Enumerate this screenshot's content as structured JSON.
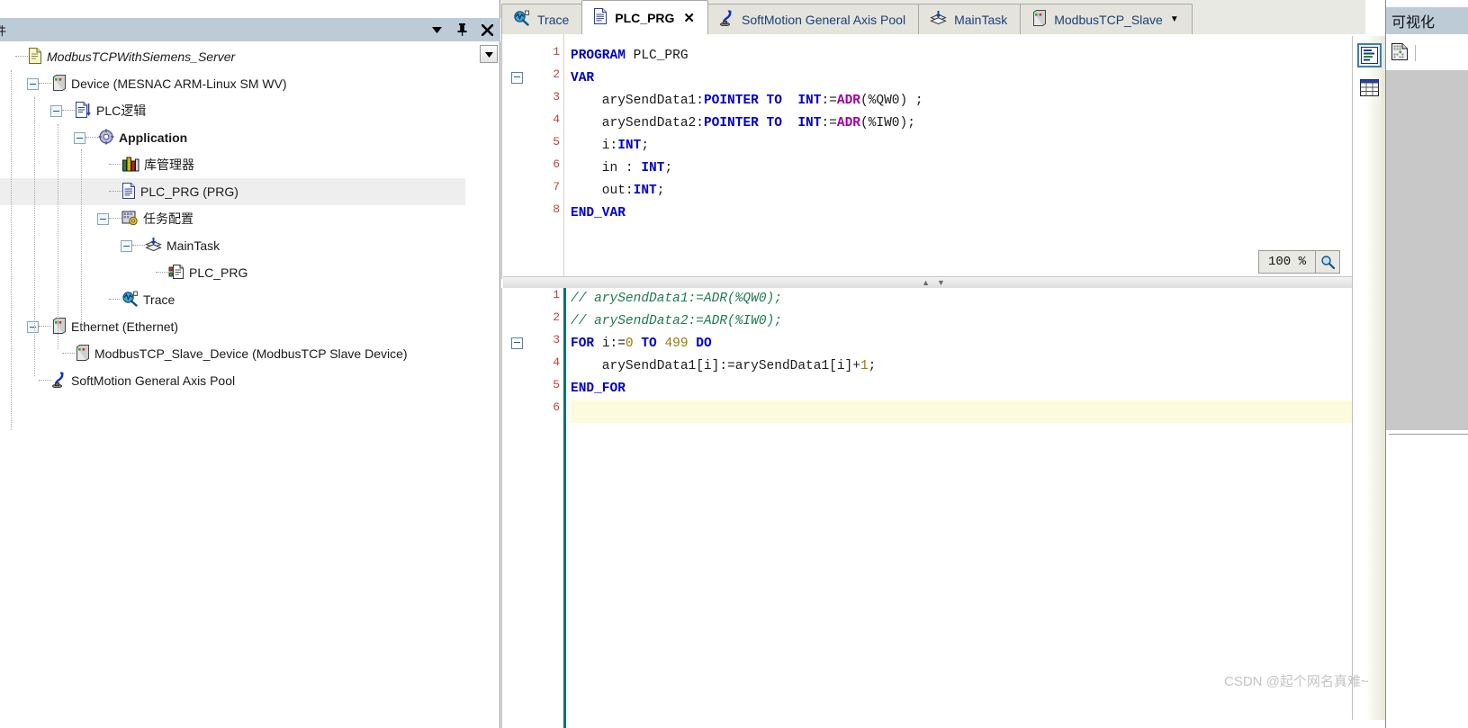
{
  "devices_panel": {
    "title": "件",
    "header_buttons": [
      {
        "name": "dropdown",
        "glyph": "▼"
      },
      {
        "name": "pin",
        "glyph": "⚐"
      },
      {
        "name": "close",
        "glyph": "✕"
      }
    ],
    "tree": [
      {
        "label": "ModbusTCPWithSiemens_Server",
        "icon": "project-icon",
        "indent": 0,
        "expander": "none",
        "style": "italic",
        "selected": false
      },
      {
        "label": "Device (MESNAC ARM-Linux SM WV)",
        "icon": "device-icon",
        "indent": 1,
        "expander": "minus",
        "style": "normal",
        "selected": false
      },
      {
        "label": "PLC逻辑",
        "icon": "plc-logic-icon",
        "indent": 2,
        "expander": "minus",
        "style": "normal",
        "selected": false
      },
      {
        "label": "Application",
        "icon": "application-icon",
        "indent": 3,
        "expander": "minus",
        "style": "bold",
        "selected": false
      },
      {
        "label": "库管理器",
        "icon": "library-manager-icon",
        "indent": 4,
        "expander": "none",
        "style": "normal",
        "selected": false
      },
      {
        "label": "PLC_PRG (PRG)",
        "icon": "pou-icon",
        "indent": 4,
        "expander": "none",
        "style": "normal",
        "selected": true
      },
      {
        "label": "任务配置",
        "icon": "task-config-icon",
        "indent": 4,
        "expander": "minus",
        "style": "normal",
        "selected": false
      },
      {
        "label": "MainTask",
        "icon": "task-icon",
        "indent": 5,
        "expander": "minus",
        "style": "normal",
        "selected": false
      },
      {
        "label": "PLC_PRG",
        "icon": "task-pou-icon",
        "indent": 6,
        "expander": "none",
        "style": "normal",
        "selected": false
      },
      {
        "label": "Trace",
        "icon": "trace-icon",
        "indent": 4,
        "expander": "none",
        "style": "normal",
        "selected": false
      },
      {
        "label": "Ethernet (Ethernet)",
        "icon": "device-icon",
        "indent": 1,
        "expander": "minus",
        "style": "normal",
        "selected": false
      },
      {
        "label": "ModbusTCP_Slave_Device (ModbusTCP Slave Device)",
        "icon": "device-icon",
        "indent": 2,
        "expander": "none",
        "style": "normal",
        "selected": false
      },
      {
        "label": "SoftMotion General Axis Pool",
        "icon": "softmotion-icon",
        "indent": 1,
        "expander": "none",
        "style": "normal",
        "selected": false
      }
    ]
  },
  "editor": {
    "tabs": [
      {
        "label": "Trace",
        "icon": "trace-icon",
        "active": false,
        "closable": false,
        "caret": false
      },
      {
        "label": "PLC_PRG",
        "icon": "pou-icon",
        "active": true,
        "closable": true,
        "caret": false
      },
      {
        "label": "SoftMotion General Axis Pool",
        "icon": "softmotion-icon",
        "active": false,
        "closable": false,
        "caret": false
      },
      {
        "label": "MainTask",
        "icon": "task-icon",
        "active": false,
        "closable": false,
        "caret": false
      },
      {
        "label": "ModbusTCP_Slave",
        "icon": "device-icon",
        "active": false,
        "closable": false,
        "caret": true
      }
    ],
    "declaration": {
      "lines": [
        {
          "n": 1,
          "fold": false,
          "tokens": [
            {
              "t": "PROGRAM ",
              "c": "kw"
            },
            {
              "t": "PLC_PRG",
              "c": "plain"
            }
          ]
        },
        {
          "n": 2,
          "fold": true,
          "tokens": [
            {
              "t": "VAR",
              "c": "kw"
            }
          ]
        },
        {
          "n": 3,
          "fold": false,
          "tokens": [
            {
              "t": "    arySendData1:",
              "c": "plain"
            },
            {
              "t": "POINTER TO  INT",
              "c": "kw"
            },
            {
              "t": ":=",
              "c": "plain"
            },
            {
              "t": "ADR",
              "c": "kwp"
            },
            {
              "t": "(%QW0) ;",
              "c": "plain"
            }
          ]
        },
        {
          "n": 4,
          "fold": false,
          "tokens": [
            {
              "t": "    arySendData2:",
              "c": "plain"
            },
            {
              "t": "POINTER TO  INT",
              "c": "kw"
            },
            {
              "t": ":=",
              "c": "plain"
            },
            {
              "t": "ADR",
              "c": "kwp"
            },
            {
              "t": "(%IW0);",
              "c": "plain"
            }
          ]
        },
        {
          "n": 5,
          "fold": false,
          "tokens": [
            {
              "t": "    i:",
              "c": "plain"
            },
            {
              "t": "INT",
              "c": "kw"
            },
            {
              "t": ";",
              "c": "plain"
            }
          ]
        },
        {
          "n": 6,
          "fold": false,
          "tokens": [
            {
              "t": "    in : ",
              "c": "plain"
            },
            {
              "t": "INT",
              "c": "kw"
            },
            {
              "t": ";",
              "c": "plain"
            }
          ]
        },
        {
          "n": 7,
          "fold": false,
          "tokens": [
            {
              "t": "    out:",
              "c": "plain"
            },
            {
              "t": "INT",
              "c": "kw"
            },
            {
              "t": ";",
              "c": "plain"
            }
          ]
        },
        {
          "n": 8,
          "fold": false,
          "tokens": [
            {
              "t": "END_VAR",
              "c": "kw"
            }
          ]
        }
      ],
      "zoom_level": "100 %"
    },
    "implementation": {
      "lines": [
        {
          "n": 1,
          "fold": false,
          "highlight": false,
          "tokens": [
            {
              "t": "// arySendData1:=ADR(%QW0);",
              "c": "cmt"
            }
          ]
        },
        {
          "n": 2,
          "fold": false,
          "highlight": false,
          "tokens": [
            {
              "t": "// arySendData2:=ADR(%IW0);",
              "c": "cmt"
            }
          ]
        },
        {
          "n": 3,
          "fold": true,
          "highlight": false,
          "tokens": [
            {
              "t": "FOR ",
              "c": "kw"
            },
            {
              "t": "i:=",
              "c": "plain"
            },
            {
              "t": "0",
              "c": "num"
            },
            {
              "t": " TO ",
              "c": "kw"
            },
            {
              "t": "499",
              "c": "num"
            },
            {
              "t": " DO",
              "c": "kw"
            }
          ]
        },
        {
          "n": 4,
          "fold": false,
          "highlight": false,
          "tokens": [
            {
              "t": "    arySendData1[i]:=arySendData1[i]+",
              "c": "plain"
            },
            {
              "t": "1",
              "c": "num"
            },
            {
              "t": ";",
              "c": "plain"
            }
          ]
        },
        {
          "n": 5,
          "fold": false,
          "highlight": false,
          "tokens": [
            {
              "t": "END_FOR",
              "c": "kw"
            }
          ]
        },
        {
          "n": 6,
          "fold": false,
          "highlight": true,
          "tokens": [
            {
              "t": "",
              "c": "plain"
            }
          ]
        }
      ]
    },
    "view_modes": [
      {
        "name": "textual-view",
        "active": true
      },
      {
        "name": "tabular-view",
        "active": false
      }
    ]
  },
  "visualization_panel": {
    "title": "可视化"
  },
  "watermark": "CSDN @起个网名真难~"
}
